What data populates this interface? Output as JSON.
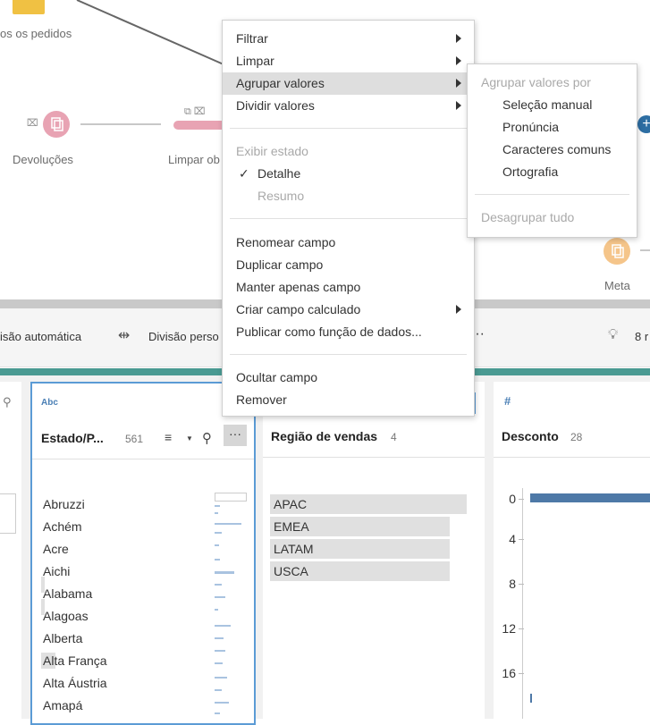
{
  "flow": {
    "nodes": [
      {
        "label": "os os pedidos"
      },
      {
        "label": "Devoluções"
      },
      {
        "label": "Limpar ob"
      },
      {
        "label": "Meta"
      }
    ]
  },
  "toolbar": {
    "auto_split": "isão automática",
    "custom_split": "Divisão perso",
    "more": "···",
    "right_count": "8 r"
  },
  "context_menu": {
    "items": [
      {
        "label": "Filtrar",
        "submenu": true
      },
      {
        "label": "Limpar",
        "submenu": true
      },
      {
        "label": "Agrupar valores",
        "submenu": true,
        "highlighted": true
      },
      {
        "label": "Dividir valores",
        "submenu": true
      },
      {
        "label": "Exibir estado",
        "disabled": true
      },
      {
        "label": "Detalhe",
        "checked": true
      },
      {
        "label": "Resumo",
        "disabled": true
      },
      {
        "label": "Renomear campo"
      },
      {
        "label": "Duplicar campo"
      },
      {
        "label": "Manter apenas campo"
      },
      {
        "label": "Criar campo calculado",
        "submenu": true
      },
      {
        "label": "Publicar como função de dados..."
      },
      {
        "label": "Ocultar campo"
      },
      {
        "label": "Remover"
      }
    ],
    "check_mark": "✓"
  },
  "group_submenu": {
    "header": "Agrupar valores por",
    "items": [
      "Seleção manual",
      "Pronúncia",
      "Caracteres comuns",
      "Ortografia"
    ],
    "ungroup": "Desagrupar tudo"
  },
  "cards": {
    "state": {
      "type_label": "Abc",
      "title": "Estado/P...",
      "count": "561",
      "items": [
        "Abruzzi",
        "Achém",
        "Acre",
        "Aichi",
        "Alabama",
        "Alagoas",
        "Alberta",
        "Alta França",
        "Alta Áustria",
        "Amapá"
      ]
    },
    "region": {
      "title": "Região de vendas",
      "count": "4",
      "items": [
        "APAC",
        "EMEA",
        "LATAM",
        "USCA"
      ]
    },
    "discount": {
      "type_label": "#",
      "title": "Desconto",
      "count": "28",
      "axis": [
        "0",
        "4",
        "8",
        "12",
        "16"
      ]
    }
  },
  "colors": {
    "accent_teal": "#4a9a92",
    "node_pink": "#e8a3b3",
    "node_orange": "#f5c58a",
    "bar_blue": "#4e79a7"
  }
}
